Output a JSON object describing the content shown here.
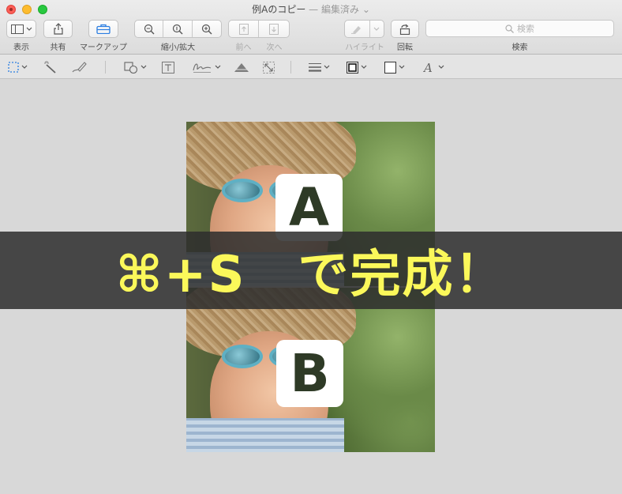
{
  "window": {
    "title": "例Aのコピー",
    "title_separator": "—",
    "edited_status": "編集済み",
    "edited_chevron": "⌄"
  },
  "toolbar": {
    "view_label": "表示",
    "share_label": "共有",
    "markup_label": "マークアップ",
    "zoom_label": "縮小/拡大",
    "prev_label": "前へ",
    "next_label": "次へ",
    "highlight_label": "ハイライト",
    "rotate_label": "回転",
    "search_label": "検索"
  },
  "search": {
    "placeholder": "検索"
  },
  "markup_tools": [
    "selection-tool",
    "instant-alpha-tool",
    "sketch-tool",
    "shapes-tool",
    "text-tool",
    "sign-tool",
    "adjust-color-tool",
    "adjust-size-tool",
    "shape-style-tool",
    "border-color-tool",
    "fill-color-tool",
    "text-style-tool"
  ],
  "canvas": {
    "badge_a": "A",
    "badge_b": "B",
    "banner_text": "⌘+S　で完成！",
    "banner_color": "#fbf85a"
  }
}
